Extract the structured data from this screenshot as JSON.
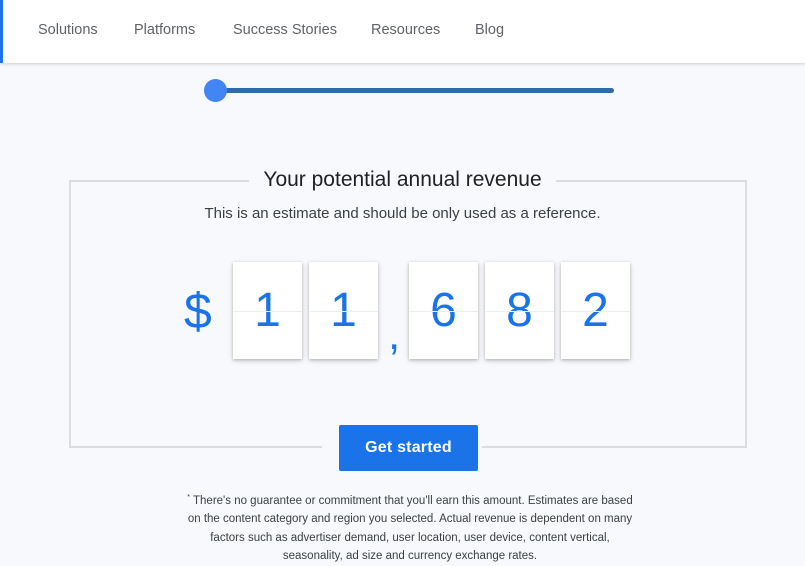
{
  "nav": {
    "items": [
      {
        "label": "Solutions"
      },
      {
        "label": "Platforms"
      },
      {
        "label": "Success Stories"
      },
      {
        "label": "Resources"
      },
      {
        "label": "Blog"
      }
    ]
  },
  "slider": {
    "level": 0
  },
  "estimate": {
    "title": "Your potential annual revenue",
    "subtitle": "This is an estimate and should be only used as a reference.",
    "currency_symbol": "$",
    "digits": [
      "1",
      "1",
      "6",
      "8",
      "2"
    ],
    "separator": ","
  },
  "cta": {
    "label": "Get started"
  },
  "disclaimer": {
    "mark": "*",
    "text": "There's no guarantee or commitment that you'll earn this amount. Estimates are based on the content category and region you selected. Actual revenue is dependent on many factors such as advertiser demand, user location, user device, content vertical, seasonality, ad size and currency exchange rates."
  },
  "colors": {
    "accent": "#1a73e8",
    "slider_track": "#2f6ba8",
    "slider_thumb": "#4285f4",
    "background": "#f7f9fc"
  }
}
